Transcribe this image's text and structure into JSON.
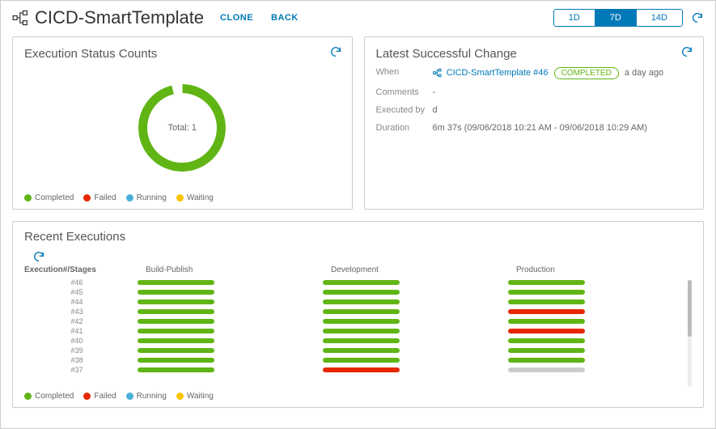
{
  "header": {
    "title": "CICD-SmartTemplate",
    "clone": "CLONE",
    "back": "BACK",
    "ranges": [
      "1D",
      "7D",
      "14D"
    ],
    "active_range": "7D"
  },
  "status_panel": {
    "title": "Execution Status Counts",
    "total_label": "Total: 1",
    "legend": {
      "completed": "Completed",
      "failed": "Failed",
      "running": "Running",
      "waiting": "Waiting"
    }
  },
  "chart_data": {
    "type": "pie",
    "title": "Execution Status Counts",
    "categories": [
      "Completed",
      "Failed",
      "Running",
      "Waiting"
    ],
    "values": [
      1,
      0,
      0,
      0
    ],
    "colors": [
      "#60b515",
      "#e62700",
      "#49afd9",
      "#fac400"
    ],
    "total": 1
  },
  "change_panel": {
    "title": "Latest Successful Change",
    "when_label": "When",
    "when_link": "CICD-SmartTemplate #46",
    "when_badge": "COMPLETED",
    "when_ago": "a day ago",
    "comments_label": "Comments",
    "comments_value": "-",
    "exec_by_label": "Executed by",
    "exec_by_value": "d",
    "duration_label": "Duration",
    "duration_value": "6m 37s (09/06/2018 10:21 AM - 09/06/2018 10:29 AM)"
  },
  "recent": {
    "title": "Recent Executions",
    "col_exec": "Execution#/Stages",
    "stages": [
      "Build-Publish",
      "Development",
      "Production"
    ],
    "rows": [
      {
        "id": "#46",
        "cells": [
          "green",
          "green",
          "green"
        ]
      },
      {
        "id": "#45",
        "cells": [
          "green",
          "green",
          "green"
        ]
      },
      {
        "id": "#44",
        "cells": [
          "green",
          "green",
          "green"
        ]
      },
      {
        "id": "#43",
        "cells": [
          "green",
          "green",
          "red"
        ]
      },
      {
        "id": "#42",
        "cells": [
          "green",
          "green",
          "green"
        ]
      },
      {
        "id": "#41",
        "cells": [
          "green",
          "green",
          "red"
        ]
      },
      {
        "id": "#40",
        "cells": [
          "green",
          "green",
          "green"
        ]
      },
      {
        "id": "#39",
        "cells": [
          "green",
          "green",
          "green"
        ]
      },
      {
        "id": "#38",
        "cells": [
          "green",
          "green",
          "green"
        ]
      },
      {
        "id": "#37",
        "cells": [
          "green",
          "red",
          "grey"
        ]
      }
    ],
    "legend": {
      "completed": "Completed",
      "failed": "Failed",
      "running": "Running",
      "waiting": "Waiting"
    }
  }
}
